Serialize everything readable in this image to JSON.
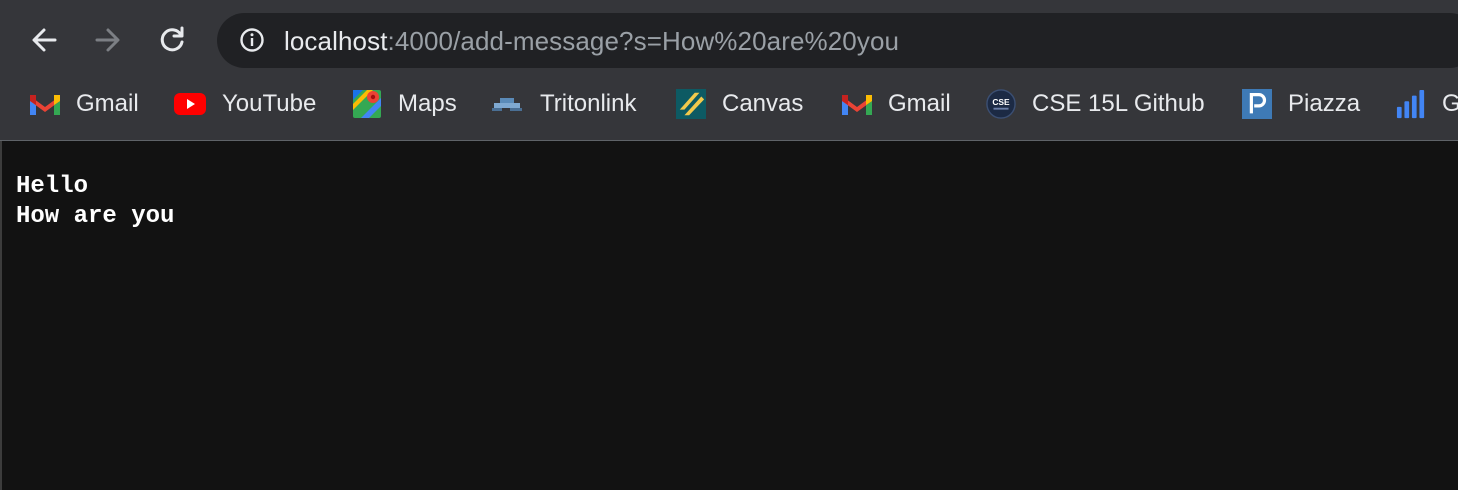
{
  "toolbar": {
    "back_icon": "arrow-left-icon",
    "forward_icon": "arrow-right-icon",
    "reload_icon": "reload-icon"
  },
  "omnibox": {
    "icon": "info-icon",
    "url_host": "localhost",
    "url_rest": ":4000/add-message?s=How%20are%20you"
  },
  "bookmarks": [
    {
      "label": "Gmail",
      "icon": "gmail-icon"
    },
    {
      "label": "YouTube",
      "icon": "youtube-icon"
    },
    {
      "label": "Maps",
      "icon": "maps-icon"
    },
    {
      "label": "Tritonlink",
      "icon": "tritonlink-icon"
    },
    {
      "label": "Canvas",
      "icon": "canvas-icon"
    },
    {
      "label": "Gmail",
      "icon": "gmail-icon"
    },
    {
      "label": "CSE 15L Github",
      "icon": "cse-icon",
      "icon_text": "CSE"
    },
    {
      "label": "Piazza",
      "icon": "piazza-icon"
    },
    {
      "label": "G",
      "icon": "analytics-icon"
    }
  ],
  "page": {
    "lines": [
      "Hello",
      "How are you"
    ]
  },
  "colors": {
    "chrome_bg": "#35363a",
    "omnibox_bg": "#202124",
    "page_bg": "#121212",
    "text_primary": "#e8eaed",
    "text_secondary": "#9aa0a6"
  }
}
